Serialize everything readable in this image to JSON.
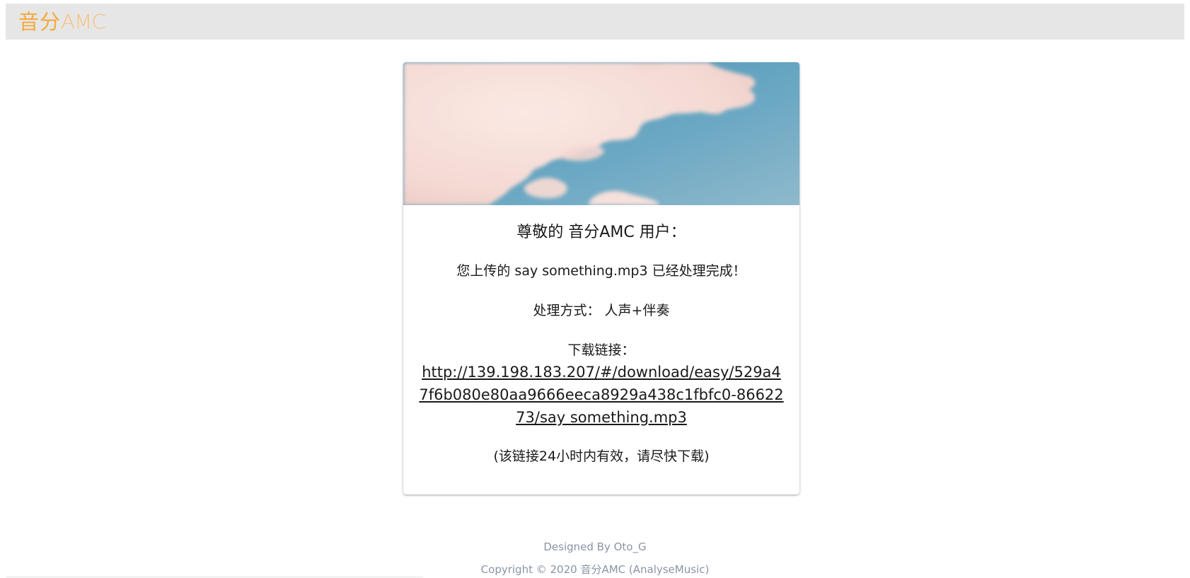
{
  "header": {
    "logo_cn": "音分",
    "logo_en": "AMC"
  },
  "card": {
    "greeting": "尊敬的 音分AMC 用户：",
    "upload_notice": "您上传的 say something.mp3 已经处理完成！",
    "process_mode": "处理方式： 人声+伴奏",
    "download_label": "下载链接：",
    "download_url": "http://139.198.183.207/#/download/easy/529a47f6b080e80aa9666eeca8929a438c1fbfc0-8662273/say something.mp3",
    "validity_note": "(该链接24小时内有效，请尽快下载)"
  },
  "footer": {
    "designed_by": "Designed By Oto_G",
    "copyright": "Copyright © 2020 音分AMC (AnalyseMusic)"
  },
  "colors": {
    "header_bg": "#e6e6e6",
    "brand_orange": "#f6a93b",
    "footer_text": "#8a94a6",
    "sky_blue": "#5d9fbd"
  }
}
